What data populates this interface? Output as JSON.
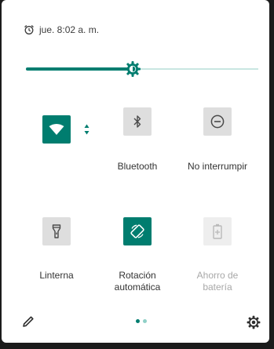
{
  "status": {
    "alarm_icon": "alarm-clock-icon",
    "alarm_text": "jue. 8:02 a. m."
  },
  "brightness": {
    "level_fraction": 0.46,
    "icon": "brightness-icon"
  },
  "tiles": [
    {
      "id": "wifi",
      "label": "",
      "icon": "wifi-icon",
      "state": "on"
    },
    {
      "id": "bluetooth",
      "label": "Bluetooth",
      "icon": "bluetooth-icon",
      "state": "off"
    },
    {
      "id": "dnd",
      "label": "No interrumpir",
      "icon": "do-not-disturb-icon",
      "state": "off"
    },
    {
      "id": "flashlight",
      "label": "Linterna",
      "icon": "flashlight-icon",
      "state": "off"
    },
    {
      "id": "rotation",
      "label_line1": "Rotación",
      "label_line2": "automática",
      "icon": "auto-rotate-icon",
      "state": "on"
    },
    {
      "id": "battery_saver",
      "label_line1": "Ahorro de",
      "label_line2": "batería",
      "icon": "battery-saver-icon",
      "state": "disabled"
    }
  ],
  "footer": {
    "edit_icon": "pencil-icon",
    "settings_icon": "gear-icon",
    "page_count": 2,
    "current_page": 1
  },
  "colors": {
    "accent": "#007d6f",
    "accent_light": "#c9e6e2",
    "tile_off": "#dedede",
    "tile_disabled": "#eeeeee"
  }
}
